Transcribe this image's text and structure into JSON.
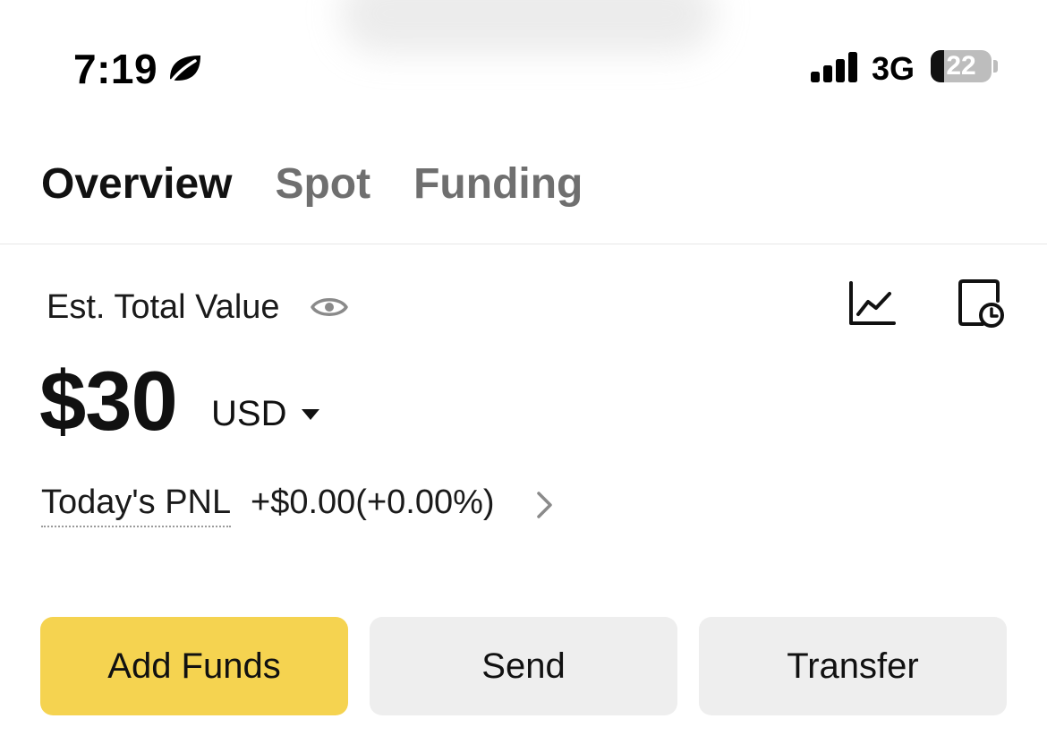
{
  "status_bar": {
    "time": "7:19",
    "focus_icon": "leaf-icon",
    "signal_icon": "cellular-signal-icon",
    "network": "3G",
    "battery_level": "22",
    "battery_fraction": 0.22
  },
  "tabs": [
    {
      "label": "Overview",
      "active": true
    },
    {
      "label": "Spot",
      "active": false
    },
    {
      "label": "Funding",
      "active": false
    }
  ],
  "summary": {
    "est_label": "Est. Total Value",
    "eye_icon": "eye-icon",
    "chart_icon": "line-chart-icon",
    "history_icon": "document-clock-icon",
    "amount": "$30",
    "currency": "USD",
    "pnl_label": "Today's PNL",
    "pnl_value": "+$0.00(+0.00%)"
  },
  "actions": {
    "add_funds": "Add Funds",
    "send": "Send",
    "transfer": "Transfer"
  },
  "colors": {
    "accent": "#f5d350",
    "secondary_button": "#eeeeee",
    "inactive_tab": "#6f6f6f"
  }
}
